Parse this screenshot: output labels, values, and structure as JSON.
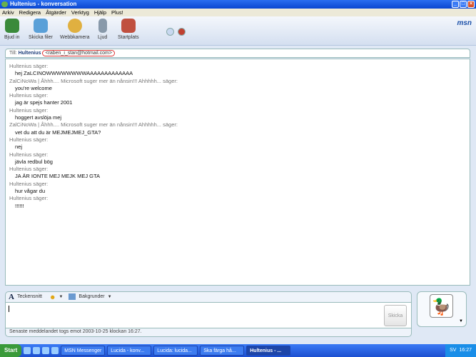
{
  "window": {
    "title": "Hultenius - konversation",
    "min": "_",
    "max": "□",
    "close": "×"
  },
  "menu": [
    "Arkiv",
    "Redigera",
    "Åtgärder",
    "Verktyg",
    "Hjälp",
    "Plus!"
  ],
  "toolbar": {
    "items": [
      "Bjud in",
      "Skicka filer",
      "Webbkamera",
      "Ljud",
      "Startplats"
    ],
    "logo": "msn"
  },
  "to": {
    "label": "Till:",
    "name": "Hultenius",
    "email": "<raben_i_stan@hotmail.com>"
  },
  "messages": [
    {
      "who": "Hultenius säger:",
      "text": "hej ZaLCINOWWWWWWWWAAAAAAAAAAAAA"
    },
    {
      "who": "ZalCiNoWa | Åhhh.... Microsoft suger mer än nånsin!!! Ahhhhh... säger:",
      "text": "you're welcome"
    },
    {
      "who": "Hultenius säger:",
      "text": "jag är spejs hanter 2001"
    },
    {
      "who": "Hultenius säger:",
      "text": "hoggert avslöja mej"
    },
    {
      "who": "ZalCiNoWa | Åhhh.... Microsoft suger mer än nånsin!!! Ahhhhh... säger:",
      "text": "vet du att du är MEJMEJMEJ_GTA?"
    },
    {
      "who": "Hultenius säger:",
      "text": "nej"
    },
    {
      "who": "Hultenius säger:",
      "text": "jävla redbul bög"
    },
    {
      "who": "Hultenius säger:",
      "text": "JA ÄR IONTE MEJ MEJK MEJ GTA"
    },
    {
      "who": "Hultenius säger:",
      "text": "hur vågar du"
    },
    {
      "who": "Hultenius säger:",
      "text": "!!!!!!"
    }
  ],
  "input": {
    "font": "Teckensnitt",
    "backgrounds": "Bakgrunder",
    "send": "Skicka",
    "value": ""
  },
  "status": "Senaste meddelandet togs emot 2003-10-25 klockan 16:27.",
  "taskbar": {
    "start": "Start",
    "tasks": [
      "MSN Messenger",
      "Lucida - konv...",
      "Lucida: lucida...",
      "Ska färga hå...",
      "Hultenius - ..."
    ],
    "tray_lang": "SV",
    "clock": "16:27"
  }
}
